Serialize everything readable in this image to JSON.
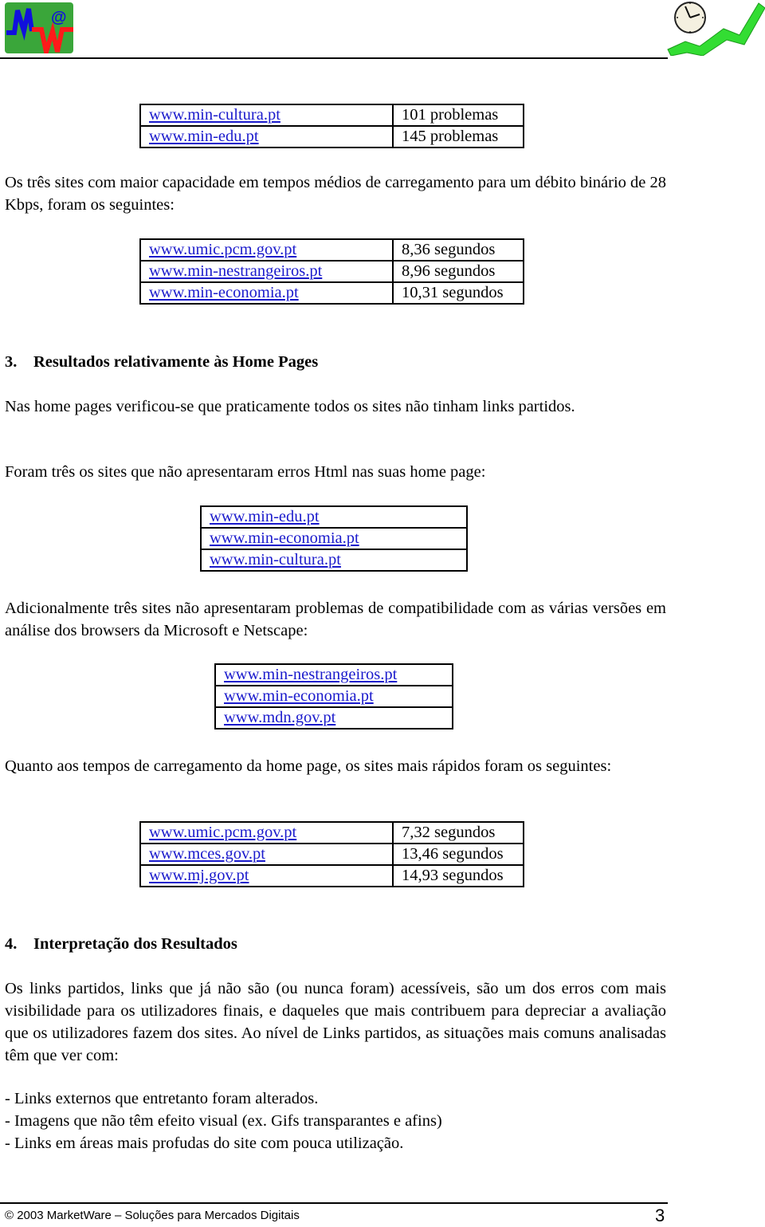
{
  "header": {
    "logo_left_letters": {
      "m": "M",
      "at": "@",
      "w": "W"
    },
    "logo_colors": {
      "bg": "#3aa63a",
      "m": "#1010dd",
      "w": "#ff1a1a",
      "at": "#1010dd"
    },
    "logo_right_icon": "clock-with-rising-chart-icon",
    "logo_right_colors": {
      "arrow": "#33dd33",
      "clock_face": "#f4f0e0"
    }
  },
  "table_problems": {
    "rows": [
      {
        "site": "www.min-cultura.pt",
        "value": "101 problemas"
      },
      {
        "site": "www.min-edu.pt",
        "value": "145 problemas"
      }
    ]
  },
  "paragraph_28kbps": "Os três sites com maior capacidade em tempos médios de carregamento para um débito binário de 28 Kbps, foram os seguintes:",
  "table_28kbps": {
    "rows": [
      {
        "site": "www.umic.pcm.gov.pt",
        "value": "8,36 segundos"
      },
      {
        "site": "www.min-nestrangeiros.pt",
        "value": "8,96 segundos"
      },
      {
        "site": "www.min-economia.pt",
        "value": "10,31 segundos"
      }
    ]
  },
  "section3": {
    "number": "3.",
    "title": "Resultados relativamente às Home Pages",
    "para1": "Nas home pages verificou-se que praticamente todos os sites não tinham links partidos.",
    "para2": "Foram três os sites que não apresentaram erros Html nas suas home page:",
    "table_no_html_errors": [
      "www.min-edu.pt",
      "www.min-economia.pt",
      "www.min-cultura.pt"
    ],
    "para3": "Adicionalmente três sites não apresentaram problemas de compatibilidade com as várias versões em análise dos browsers da Microsoft e Netscape:",
    "table_compat": [
      "www.min-nestrangeiros.pt",
      "www.min-economia.pt",
      "www.mdn.gov.pt"
    ],
    "para4": "Quanto aos tempos de carregamento da home page, os sites mais rápidos foram os seguintes:",
    "table_fastest": {
      "rows": [
        {
          "site": "www.umic.pcm.gov.pt",
          "value": "7,32 segundos"
        },
        {
          "site": "www.mces.gov.pt",
          "value": "13,46 segundos"
        },
        {
          "site": "www.mj.gov.pt",
          "value": "14,93 segundos"
        }
      ]
    }
  },
  "section4": {
    "number": "4.",
    "title": "Interpretação dos Resultados",
    "para1": "Os links partidos, links que já não são (ou nunca foram) acessíveis, são um dos erros com mais visibilidade para os utilizadores finais, e daqueles que mais contribuem para depreciar a avaliação que os utilizadores fazem dos sites. Ao nível de Links partidos, as situações mais comuns analisadas têm que ver com:",
    "list": [
      "- Links externos que entretanto foram alterados.",
      "- Imagens que não têm efeito visual (ex. Gifs transparantes e afins)",
      "- Links em áreas mais profudas do site com pouca utilização."
    ]
  },
  "footer": {
    "copyright": "© 2003 MarketWare – Soluções para Mercados Digitais",
    "page_number": "3"
  }
}
